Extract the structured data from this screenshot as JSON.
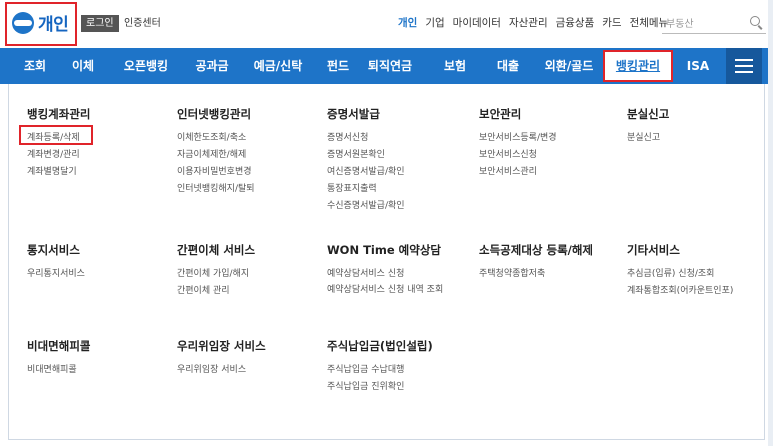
{
  "header": {
    "logo_text": "개인",
    "login_label": "로그인",
    "cert_label": "인증센터",
    "top_nav": [
      "개인",
      "기업",
      "마이데이터",
      "자산관리",
      "금융상품",
      "카드",
      "전체메뉴"
    ],
    "search_placeholder": "부동산"
  },
  "gnb": {
    "items": [
      "조회",
      "이체",
      "오픈뱅킹",
      "공과금",
      "예금/신탁",
      "펀드",
      "퇴직연금",
      "보험",
      "대출",
      "외환/골드",
      "뱅킹관리",
      "ISA"
    ],
    "active": "뱅킹관리"
  },
  "menu": {
    "sections": [
      {
        "title": "뱅킹계좌관리",
        "items": [
          "계좌등록/삭제",
          "계좌변경/관리",
          "계좌별명달기"
        ]
      },
      {
        "title": "인터넷뱅킹관리",
        "items": [
          "이체한도조회/축소",
          "자금이체제한/해제",
          "이용자비밀번호변경",
          "인터넷뱅킹해지/탈퇴"
        ]
      },
      {
        "title": "증명서발급",
        "items": [
          "증명서신청",
          "증명서원본확인",
          "여신증명서발급/확인",
          "통장표지출력",
          "수신증명서발급/확인"
        ]
      },
      {
        "title": "보안관리",
        "items": [
          "보안서비스등록/변경",
          "보안서비스신청",
          "보안서비스관리"
        ]
      },
      {
        "title": "분실신고",
        "items": [
          "분실신고"
        ]
      },
      {
        "title": "통지서비스",
        "items": [
          "우리통지서비스"
        ]
      },
      {
        "title": "간편이체 서비스",
        "items": [
          "간편이체 가입/해지",
          "간편이체 관리"
        ]
      },
      {
        "title": "WON Time 예약상담",
        "items": [
          "예약상담서비스 신청",
          "예약상담서비스 신청 내역 조회"
        ]
      },
      {
        "title": "소득공제대상 등록/해제",
        "items": [
          "주택청약종합저축"
        ]
      },
      {
        "title": "기타서비스",
        "items": [
          "추심금(입류) 신청/조회",
          "계좌통합조회(어카운트인포)"
        ]
      },
      {
        "title": "비대면해피콜",
        "items": [
          "비대면해피콜"
        ]
      },
      {
        "title": "우리위임장 서비스",
        "items": [
          "우리위임장 서비스"
        ]
      },
      {
        "title": "주식납입금(법인설립)",
        "items": [
          "주식납입금 수납대행",
          "주식납입금 진위확인"
        ]
      }
    ]
  }
}
